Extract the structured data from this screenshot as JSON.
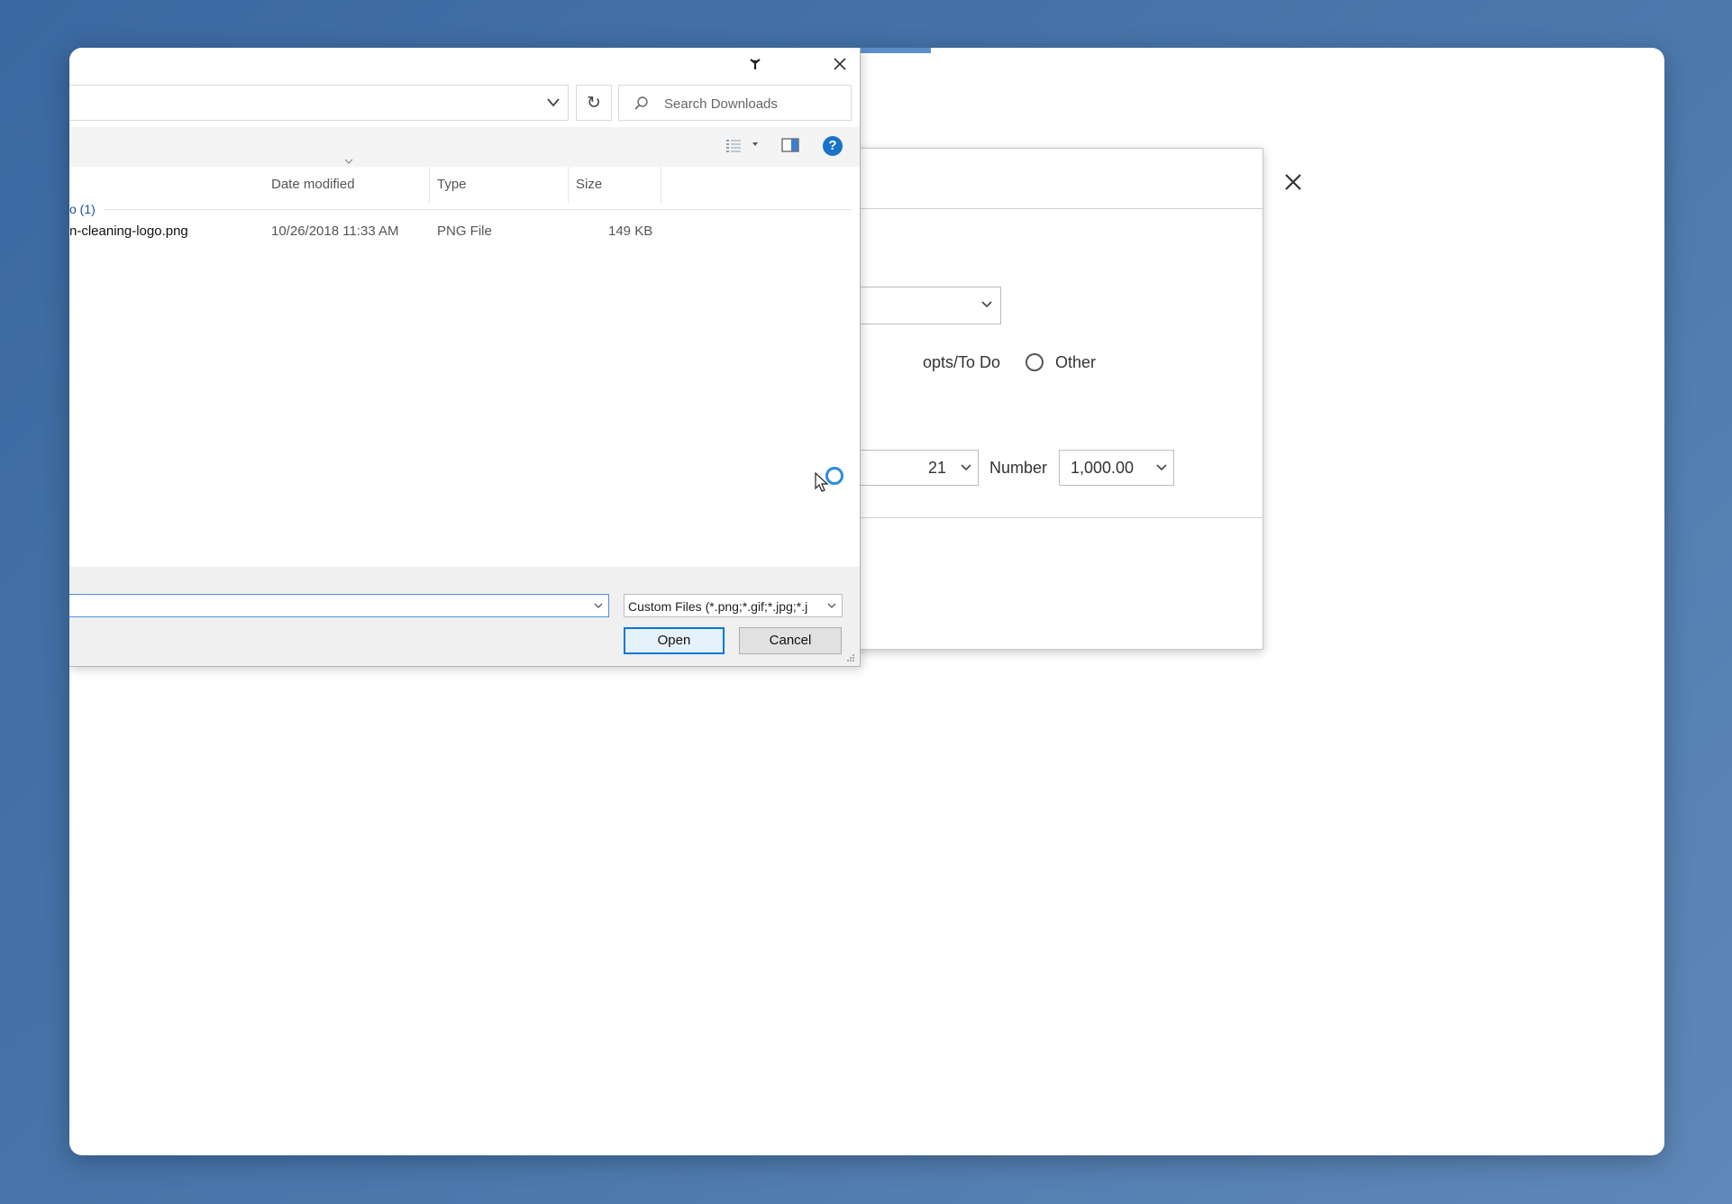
{
  "file_dialog": {
    "search_placeholder": "Search Downloads",
    "columns": {
      "date": "Date modified",
      "type": "Type",
      "size": "Size"
    },
    "group_label": "o (1)",
    "file": {
      "name": "n-cleaning-logo.png",
      "date": "10/26/2018 11:33 AM",
      "type": "PNG File",
      "size": "149 KB"
    },
    "filename_value": "",
    "filetype_value": "Custom Files (*.png;*.gif;*.jpg;*.j",
    "open_label": "Open",
    "cancel_label": "Cancel",
    "help_glyph": "?",
    "refresh_glyph": "↻"
  },
  "background_dialog": {
    "radio_partial_label": "opts/To Do",
    "radio_other_label": "Other",
    "year_partial_value": "21",
    "number_label": "Number",
    "number_value": "1,000.00"
  },
  "colors": {
    "desktop": "#4a78ad",
    "accent": "#0078d7",
    "help": "#1a73c8",
    "group_text": "#1e4e96"
  }
}
